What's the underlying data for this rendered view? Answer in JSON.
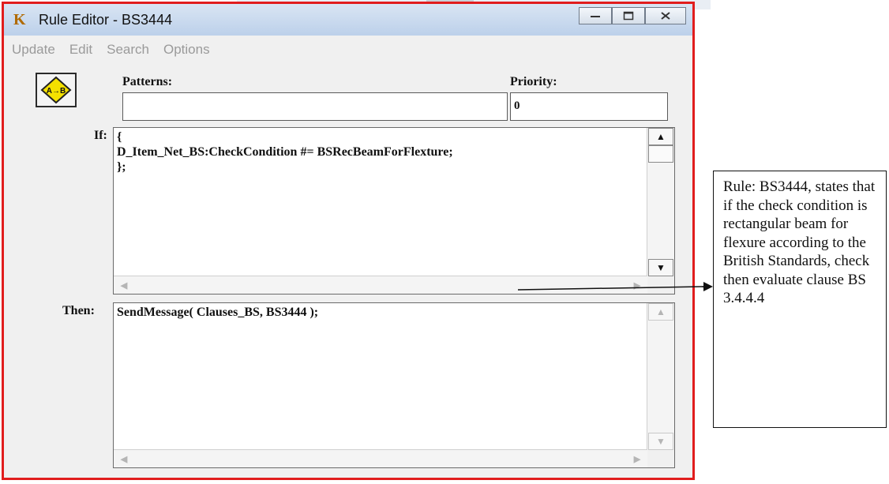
{
  "window": {
    "title": "Rule Editor - BS3444",
    "app_icon_letter": "K",
    "buttons": [
      "minimize-icon",
      "maximize-icon",
      "close-icon"
    ]
  },
  "menu": [
    "Update",
    "Edit",
    "Search",
    "Options"
  ],
  "labels": {
    "patterns": "Patterns:",
    "priority": "Priority:",
    "if": "If:",
    "then": "Then:"
  },
  "fields": {
    "patterns_value": "",
    "priority_value": "0"
  },
  "editors": {
    "if_code": "{\nD_Item_Net_BS:CheckCondition #= BSRecBeamForFlexture;\n};",
    "then_code": "SendMessage( Clauses_BS, BS3444 );"
  },
  "callout": {
    "text": "Rule: BS3444, states that if the check condition is rectangular beam for flexure according to the British Standards, check then evaluate clause BS 3.4.4.4"
  },
  "colors": {
    "window_border": "#e11d1d",
    "rule_icon": "#f4e000"
  }
}
